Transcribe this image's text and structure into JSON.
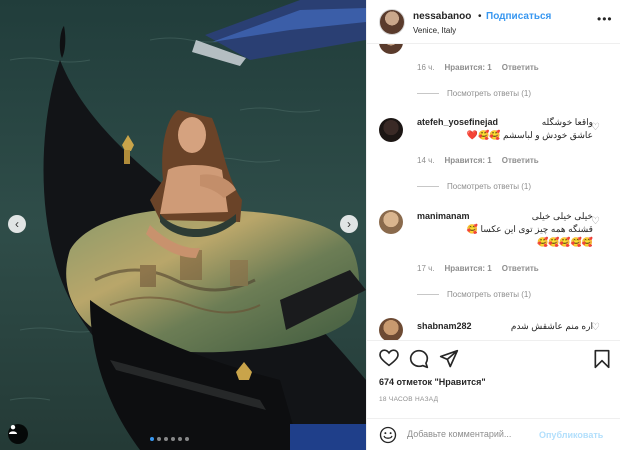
{
  "post": {
    "owner": "nessabanoo",
    "follow_separator": "•",
    "follow_label": "Подписаться",
    "location": "Venice, Italy",
    "more_label": "•••"
  },
  "photo": {
    "prev_icon": "chevron-left-icon",
    "next_icon": "chevron-right-icon",
    "tag_icon": "user-tag-icon",
    "carousel": {
      "count": 6,
      "active": 1
    }
  },
  "comments": [
    {
      "time": "16 ч.",
      "likes": "Нравится: 1",
      "reply": "Ответить",
      "view_replies": "Посмотреть ответы (1)"
    },
    {
      "user": "atefeh_yosefinejad",
      "text_line1": "واقعا خوشگله",
      "text_line2": "عاشق خودش و لباسشم 🥰🥰❤️",
      "time": "14 ч.",
      "likes": "Нравится: 1",
      "reply": "Ответить",
      "view_replies": "Посмотреть ответы (1)"
    },
    {
      "user": "manimanam",
      "text_line1": "خیلی خیلی خیلی",
      "text_line2": "قشنگه همه چیز توی این عکسا 🥰",
      "text_line3": "🥰🥰🥰🥰🥰",
      "time": "17 ч.",
      "likes": "Нравится: 1",
      "reply": "Ответить",
      "view_replies": "Посмотреть ответы (1)"
    },
    {
      "user": "shabnam282",
      "text_line1": "اره منم عاشقش شدم"
    }
  ],
  "actions": {
    "like_icon": "heart-icon",
    "comment_icon": "comment-icon",
    "share_icon": "paper-plane-icon",
    "save_icon": "bookmark-icon",
    "likes_count": "674 отметок \"Нравится\"",
    "time_ago": "18 ЧАСОВ НАЗАД"
  },
  "add_comment": {
    "emoji_icon": "smiley-icon",
    "placeholder": "Добавьте комментарий...",
    "publish_label": "Опубликовать"
  },
  "colors": {
    "link_blue": "#3897f0",
    "publish_disabled": "#b2dffc",
    "muted_text": "#8e8e8e",
    "border": "#efefef"
  }
}
